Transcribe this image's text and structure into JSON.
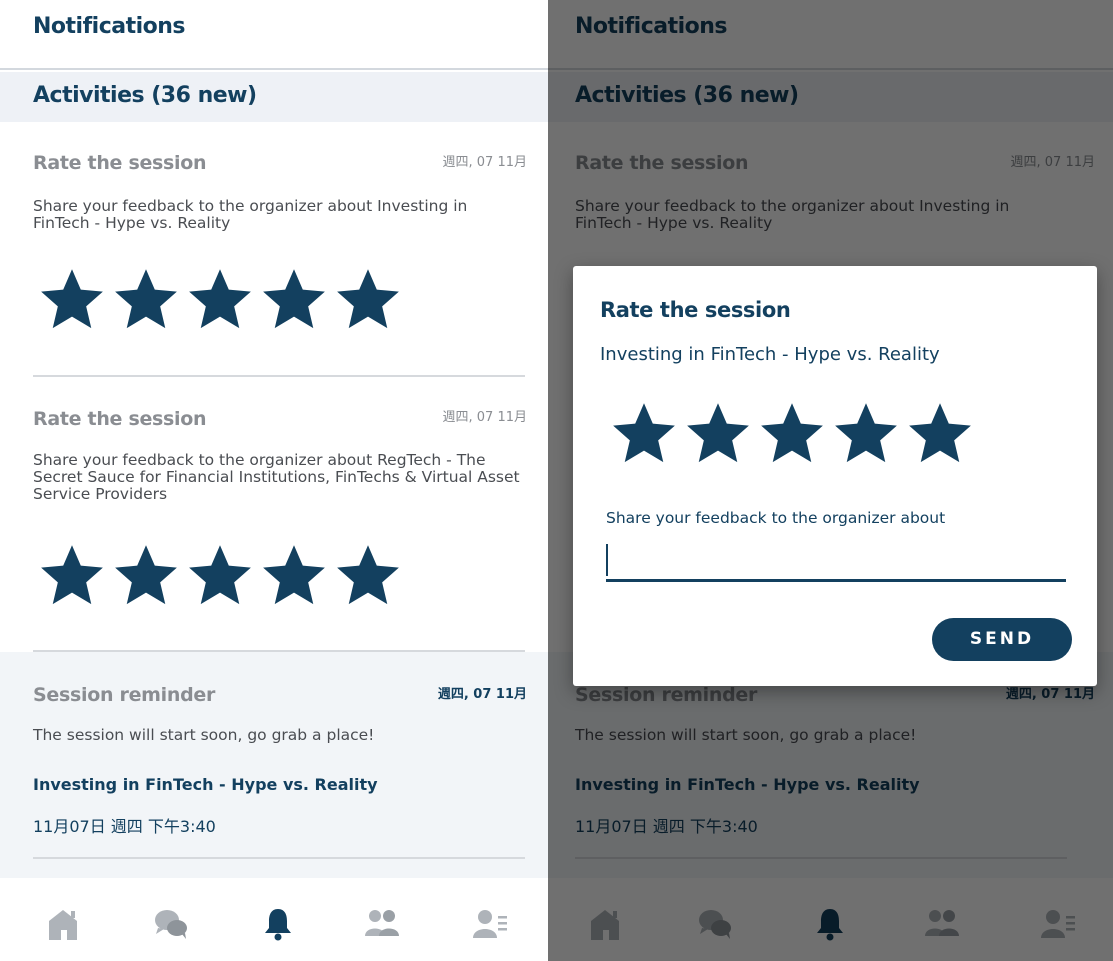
{
  "header": {
    "title": "Notifications"
  },
  "section": {
    "title": "Activities (36 new)"
  },
  "notifications": [
    {
      "title": "Rate the session",
      "date": "週四, 07 11月",
      "body": "Share your feedback to the organizer about Investing in FinTech - Hype vs. Reality",
      "rating": 5
    },
    {
      "title": "Rate the session",
      "date": "週四, 07 11月",
      "body": "Share your feedback to the organizer about RegTech - The Secret Sauce for Financial Institutions, FinTechs & Virtual Asset Service Providers",
      "rating": 5
    },
    {
      "title": "Session reminder",
      "date": "週四, 07 11月",
      "body": "The session will start soon, go grab a place!",
      "session": "Investing in FinTech - Hype vs. Reality",
      "time": "11月07日 週四 下午3:40"
    }
  ],
  "tabs": [
    {
      "icon": "home-icon"
    },
    {
      "icon": "chat-icon"
    },
    {
      "icon": "bell-icon",
      "active": true
    },
    {
      "icon": "people-icon"
    },
    {
      "icon": "profile-icon"
    }
  ],
  "dialog": {
    "title": "Rate the session",
    "subtitle": "Investing in FinTech - Hype vs. Reality",
    "rating": 5,
    "feedback_label": "Share your feedback to the organizer about",
    "feedback_value": "",
    "send_label": "SEND"
  },
  "colors": {
    "brand": "#13405f",
    "muted_text": "#8a8d92",
    "section_bg": "#eef1f6",
    "reminder_bg": "#f2f5f8"
  }
}
